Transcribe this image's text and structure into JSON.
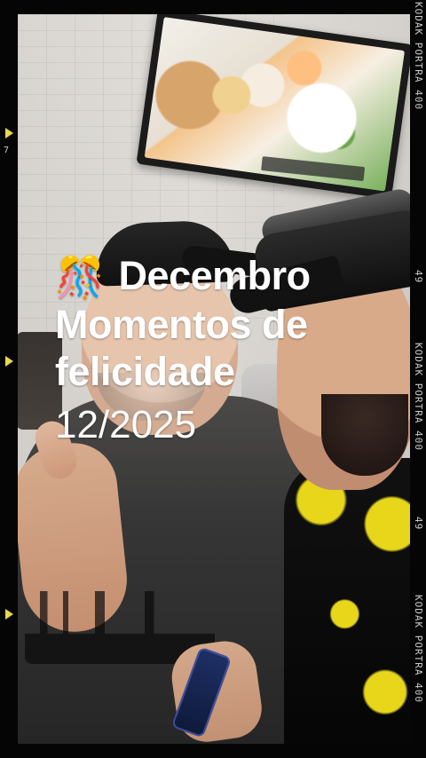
{
  "overlay": {
    "line1": "Decembro",
    "line2": "Momentos de",
    "line3": "felicidade",
    "date": "12/2025",
    "emoji": "🎊"
  },
  "film": {
    "label_top": "KODAK PORTRA 400",
    "label_mid_1": "49",
    "label_mid_2": "KODAK PORTRA 400",
    "label_bottom_1": "49",
    "label_bottom_2": "KODAK PORTRA 400",
    "frame_number": "7"
  }
}
